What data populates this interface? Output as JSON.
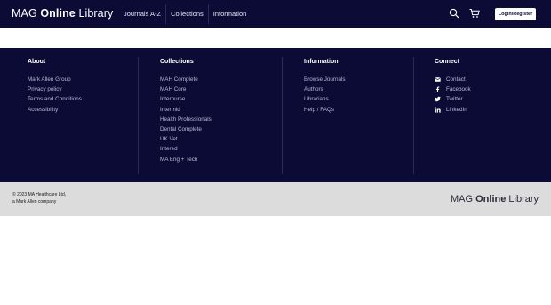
{
  "header": {
    "logo": {
      "prefix": "MAG",
      "bold": "Online",
      "suffix": "Library"
    },
    "nav": [
      "Journals A-Z",
      "Collections",
      "Information"
    ],
    "icons": [
      "search-icon",
      "cart-icon"
    ],
    "login_label": "Login/Register"
  },
  "footer": {
    "about": {
      "title": "About",
      "items": [
        "Mark Allen Group",
        "Privacy policy",
        "Terms and Conditions",
        "Accessibility"
      ]
    },
    "collections": {
      "title": "Collections",
      "items": [
        "MAH Complete",
        "MAH Core",
        "Internurse",
        "Intermid",
        "Health Professionals",
        "Dental Complete",
        "UK Vet",
        "Intered",
        "MA Eng + Tech"
      ]
    },
    "information": {
      "title": "Information",
      "items": [
        "Browse Journals",
        "Authors",
        "Librarians",
        "Help / FAQs"
      ]
    },
    "connect": {
      "title": "Connect",
      "items": [
        {
          "label": "Contact",
          "icon": "envelope-icon"
        },
        {
          "label": "Facebook",
          "icon": "facebook-icon"
        },
        {
          "label": "Twitter",
          "icon": "twitter-icon"
        },
        {
          "label": "LinkedIn",
          "icon": "linkedin-icon"
        }
      ]
    }
  },
  "bottom": {
    "copyright_line1": "© 2023 MA Healthcare Ltd,",
    "copyright_line2": "a Mark Allen company",
    "logo": {
      "prefix": "MAG",
      "bold": "Online",
      "suffix": "Library"
    }
  },
  "colors": {
    "navy": "#0b0b36",
    "bottom_bar": "#dcdcdc",
    "link": "#b9b9d6"
  }
}
